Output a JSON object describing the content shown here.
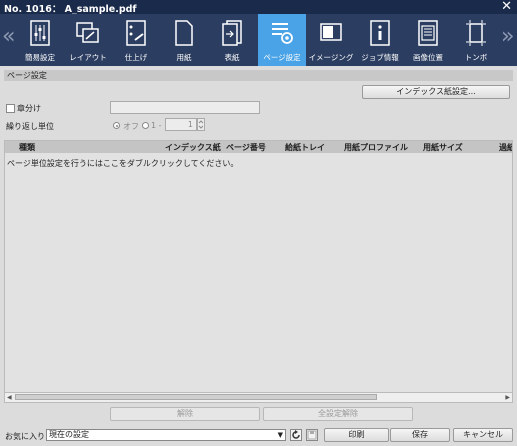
{
  "window": {
    "title": "No. 1016： A_sample.pdf",
    "close": "✕"
  },
  "toolbar": {
    "tabs": [
      {
        "label": "簡易設定",
        "icon": "sliders-icon"
      },
      {
        "label": "レイアウト",
        "icon": "layout-icon"
      },
      {
        "label": "仕上げ",
        "icon": "finishing-icon"
      },
      {
        "label": "用紙",
        "icon": "paper-icon"
      },
      {
        "label": "表紙",
        "icon": "cover-icon"
      },
      {
        "label": "ページ設定",
        "icon": "page-settings-icon",
        "active": true
      },
      {
        "label": "イメージング",
        "icon": "imaging-icon"
      },
      {
        "label": "ジョブ情報",
        "icon": "info-icon"
      },
      {
        "label": "画像位置",
        "icon": "image-position-icon"
      },
      {
        "label": "トンボ",
        "icon": "trim-marks-icon"
      }
    ],
    "prev": "«",
    "next": "»"
  },
  "page_settings": {
    "header": "ページ設定",
    "index_button": "インデックス紙設定...",
    "chapter_label": "章分け",
    "chapter_value": "",
    "repeat_label": "繰り返し単位",
    "repeat_off": "オフ",
    "repeat_one": "1 -",
    "repeat_value": "1"
  },
  "table": {
    "columns": [
      "種類",
      "インデックス紙",
      "ページ番号",
      "給紙トレイ",
      "用紙プロファイル",
      "用紙サイズ",
      "過紙"
    ],
    "empty_message": "ページ単位設定を行うにはここをダブルクリックしてください。"
  },
  "actions": {
    "clear": "解除",
    "clear_all": "全設定解除"
  },
  "footer": {
    "favorites_label": "お気に入り",
    "favorites_value": "現在の設定",
    "print": "印刷",
    "save": "保存",
    "cancel": "キャンセル"
  },
  "colors": {
    "titlebar": "#1a2a4a",
    "toolbar": "#2b3d60",
    "active_tab": "#4aa3e6"
  }
}
